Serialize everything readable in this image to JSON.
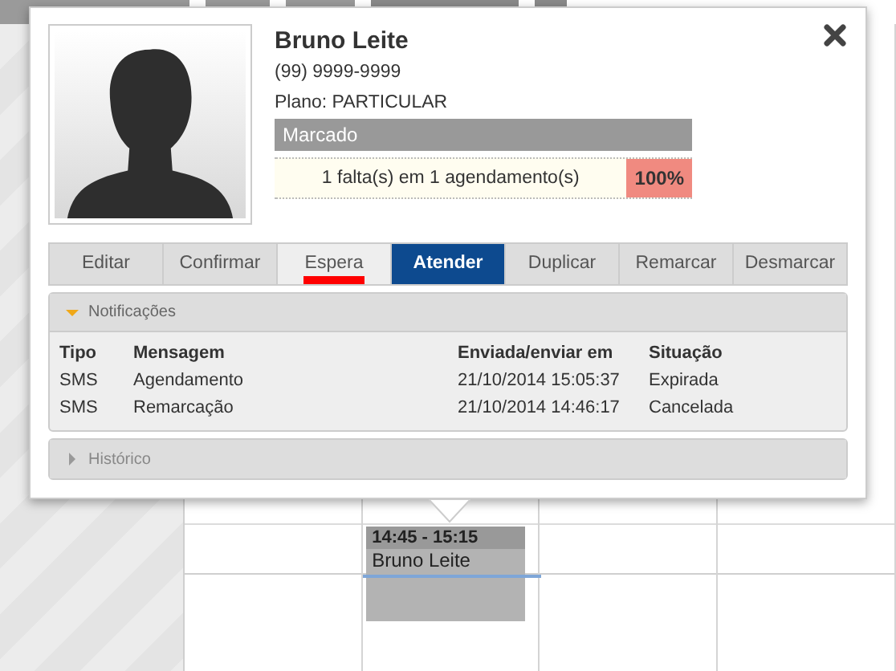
{
  "patient": {
    "name": "Bruno Leite",
    "phone": "(99) 9999-9999",
    "plan": "Plano: PARTICULAR",
    "status": "Marcado",
    "absences": "1 falta(s) em 1 agendamento(s)",
    "absence_rate": "100%"
  },
  "actions": [
    {
      "label": "Editar",
      "selected": false,
      "marked": false
    },
    {
      "label": "Confirmar",
      "selected": false,
      "marked": false
    },
    {
      "label": "Espera",
      "selected": false,
      "marked": true
    },
    {
      "label": "Atender",
      "selected": true,
      "marked": false
    },
    {
      "label": "Duplicar",
      "selected": false,
      "marked": false
    },
    {
      "label": "Remarcar",
      "selected": false,
      "marked": false
    },
    {
      "label": "Desmarcar",
      "selected": false,
      "marked": false
    }
  ],
  "panels": [
    {
      "title": "Notificações",
      "expanded": true,
      "columns": [
        "Tipo",
        "Mensagem",
        "Enviada/enviar em",
        "Situação"
      ],
      "rows": [
        [
          "SMS",
          "Agendamento",
          "21/10/2014 15:05:37",
          "Expirada"
        ],
        [
          "SMS",
          "Remarcação",
          "21/10/2014 14:46:17",
          "Cancelada"
        ]
      ]
    },
    {
      "title": "Histórico",
      "expanded": false
    }
  ],
  "event": {
    "time": "14:45 - 15:15",
    "name": "Bruno Leite"
  }
}
